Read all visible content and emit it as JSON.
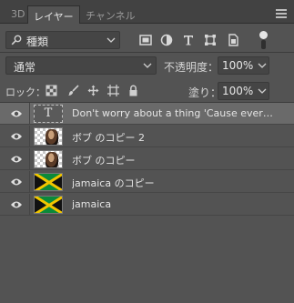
{
  "tabs": [
    {
      "label": "3D",
      "active": false
    },
    {
      "label": "レイヤー",
      "active": true
    },
    {
      "label": "チャンネル",
      "active": false
    }
  ],
  "filter": {
    "kind_label": "種類",
    "icons": [
      "image-filter-icon",
      "adjustment-filter-icon",
      "type-filter-icon",
      "shape-filter-icon",
      "smart-object-filter-icon"
    ]
  },
  "blend": {
    "mode_label": "通常",
    "opacity_label": "不透明度：",
    "opacity_value": "100%"
  },
  "lock": {
    "label": "ロック：",
    "icons": [
      "lock-transparent-pixels-icon",
      "lock-image-pixels-icon",
      "lock-position-icon",
      "lock-artboard-icon",
      "lock-all-icon"
    ],
    "fill_label": "塗り：",
    "fill_value": "100%"
  },
  "layers": [
    {
      "name": "Don't worry about a thing 'Cause every ...",
      "type": "text",
      "visible": true,
      "selected": true
    },
    {
      "name": "ボブ のコピー 2",
      "type": "photo",
      "visible": true,
      "selected": false
    },
    {
      "name": "ボブ のコピー",
      "type": "photo",
      "visible": true,
      "selected": false
    },
    {
      "name": "jamaica のコピー",
      "type": "flag",
      "visible": true,
      "selected": false
    },
    {
      "name": "jamaica",
      "type": "flag",
      "visible": true,
      "selected": false
    }
  ],
  "text_thumb_glyph": "T",
  "dropdown_glyph": "⌄"
}
